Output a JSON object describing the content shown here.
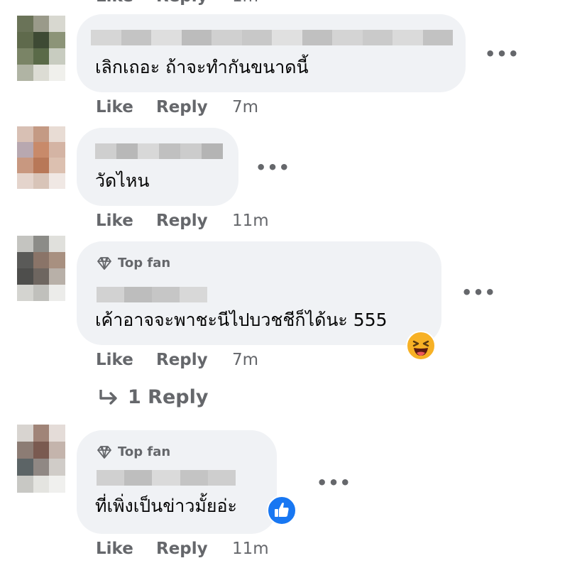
{
  "comments": [
    {
      "text": "เลิกเถอะ ถ้าจะทำกันขนาดนี้",
      "like": "Like",
      "reply": "Reply",
      "time": "7m",
      "more": "•••"
    },
    {
      "text": "วัดไหน",
      "like": "Like",
      "reply": "Reply",
      "time": "11m",
      "more": "•••"
    },
    {
      "badge": "Top fan",
      "text": "เค้าอาจจะพาชะนีไปบวชชีก็ได้นะ 555",
      "like": "Like",
      "reply": "Reply",
      "time": "7m",
      "more": "•••",
      "reaction_icon": "haha-icon",
      "replies_label": "1 Reply"
    },
    {
      "badge": "Top fan",
      "text": "ที่เพิ่งเป็นข่าวมั้ยอ่ะ",
      "like": "Like",
      "reply": "Reply",
      "time": "11m",
      "more": "•••",
      "reaction_icon": "like-icon"
    }
  ],
  "colors": {
    "bubble": "#f0f2f5",
    "meta_text": "#65676b",
    "like_blue": "#1877f2",
    "haha_yellow": "#f7b125"
  }
}
